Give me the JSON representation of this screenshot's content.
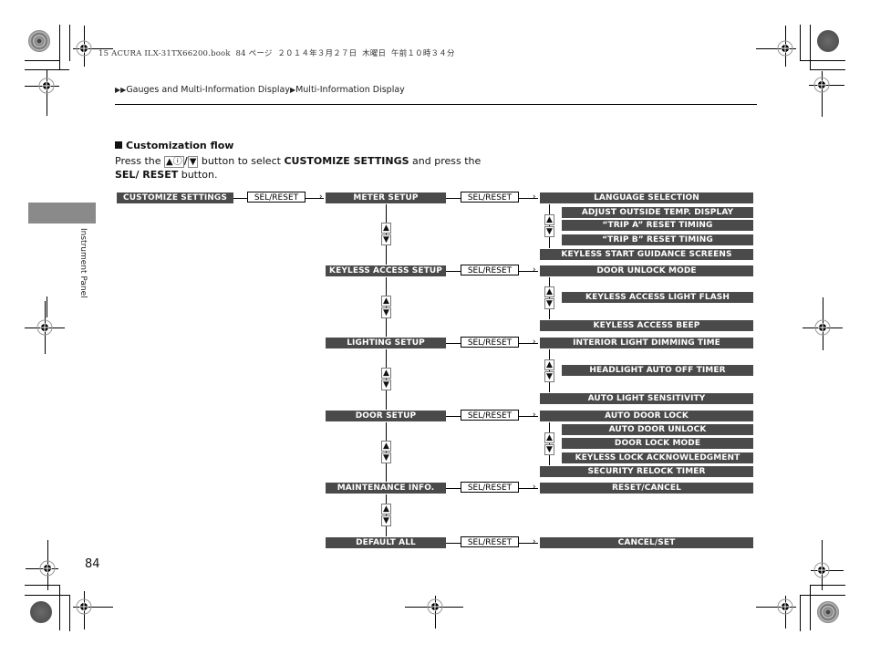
{
  "print_header": {
    "file_info": "15 ACURA ILX-31TX66200.book  84 ページ  ２０１４年３月２７日  木曜日  午前１０時３４分"
  },
  "breadcrumb": {
    "marker": "▶▶",
    "items": [
      "Gauges and Multi-Information Display",
      "Multi-Information Display"
    ],
    "separator": "▶"
  },
  "side_tab": {
    "label": "Instrument Panel"
  },
  "section": {
    "title": "Customization flow",
    "intro_prefix": "Press the ",
    "key_up": "▲ⓘ",
    "key_sep": "/",
    "key_down": "▼",
    "intro_mid": " button to select ",
    "intro_bold1": "CUSTOMIZE SETTINGS",
    "intro_mid2": " and press the ",
    "intro_bold2": "SEL/ RESET",
    "intro_end": " button."
  },
  "flow": {
    "start": "CUSTOMIZE SETTINGS",
    "sel_reset_label": "SEL/RESET",
    "up_icon": "▲",
    "down_icon": "▼",
    "groups": [
      {
        "name": "METER SETUP",
        "items": [
          "LANGUAGE SELECTION",
          "ADJUST OUTSIDE TEMP. DISPLAY",
          "“TRIP A” RESET TIMING",
          "“TRIP B” RESET TIMING",
          "KEYLESS START GUIDANCE SCREENS"
        ]
      },
      {
        "name": "KEYLESS ACCESS SETUP",
        "items": [
          "DOOR UNLOCK MODE",
          "KEYLESS ACCESS LIGHT FLASH",
          "KEYLESS ACCESS BEEP"
        ]
      },
      {
        "name": "LIGHTING SETUP",
        "items": [
          "INTERIOR LIGHT DIMMING TIME",
          "HEADLIGHT AUTO OFF TIMER",
          "AUTO LIGHT SENSITIVITY"
        ]
      },
      {
        "name": "DOOR SETUP",
        "items": [
          "AUTO DOOR LOCK",
          "AUTO DOOR UNLOCK",
          "DOOR LOCK MODE",
          "KEYLESS LOCK ACKNOWLEDGMENT",
          "SECURITY RELOCK TIMER"
        ]
      },
      {
        "name": "MAINTENANCE INFO.",
        "items": [
          "RESET/CANCEL"
        ]
      },
      {
        "name": "DEFAULT ALL",
        "items": [
          "CANCEL/SET"
        ]
      }
    ]
  },
  "page_number": "84"
}
